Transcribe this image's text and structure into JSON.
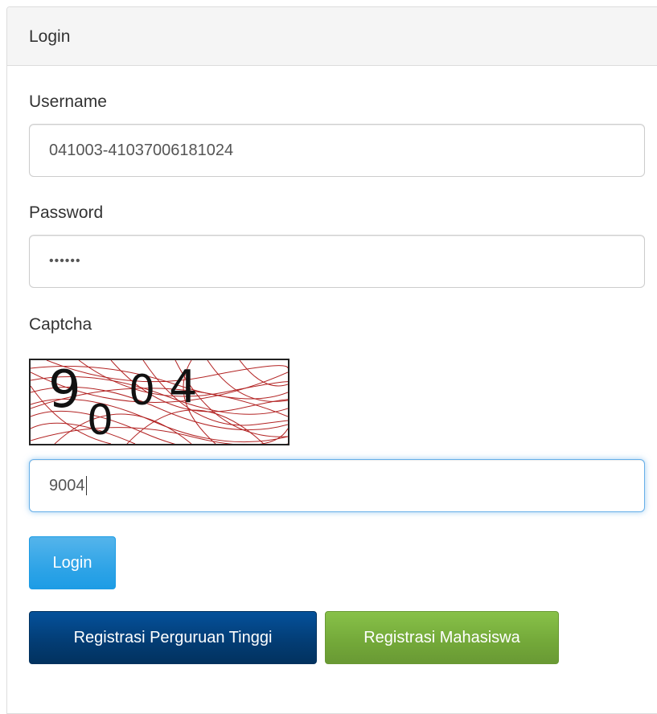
{
  "panel": {
    "title": "Login"
  },
  "form": {
    "username_label": "Username",
    "username_value": "041003-41037006181024",
    "password_label": "Password",
    "password_mask": "••••••",
    "captcha_label": "Captcha",
    "captcha_text": "9004",
    "captcha_value": "9004"
  },
  "buttons": {
    "login": "Login",
    "register_institution": "Registrasi Perguruan Tinggi",
    "register_student": "Registrasi Mahasiswa"
  },
  "colors": {
    "login_button": "#2fa4e7",
    "register_institution_button": "#033c73",
    "register_student_button": "#73a839",
    "captcha_lines": "#b22222"
  }
}
